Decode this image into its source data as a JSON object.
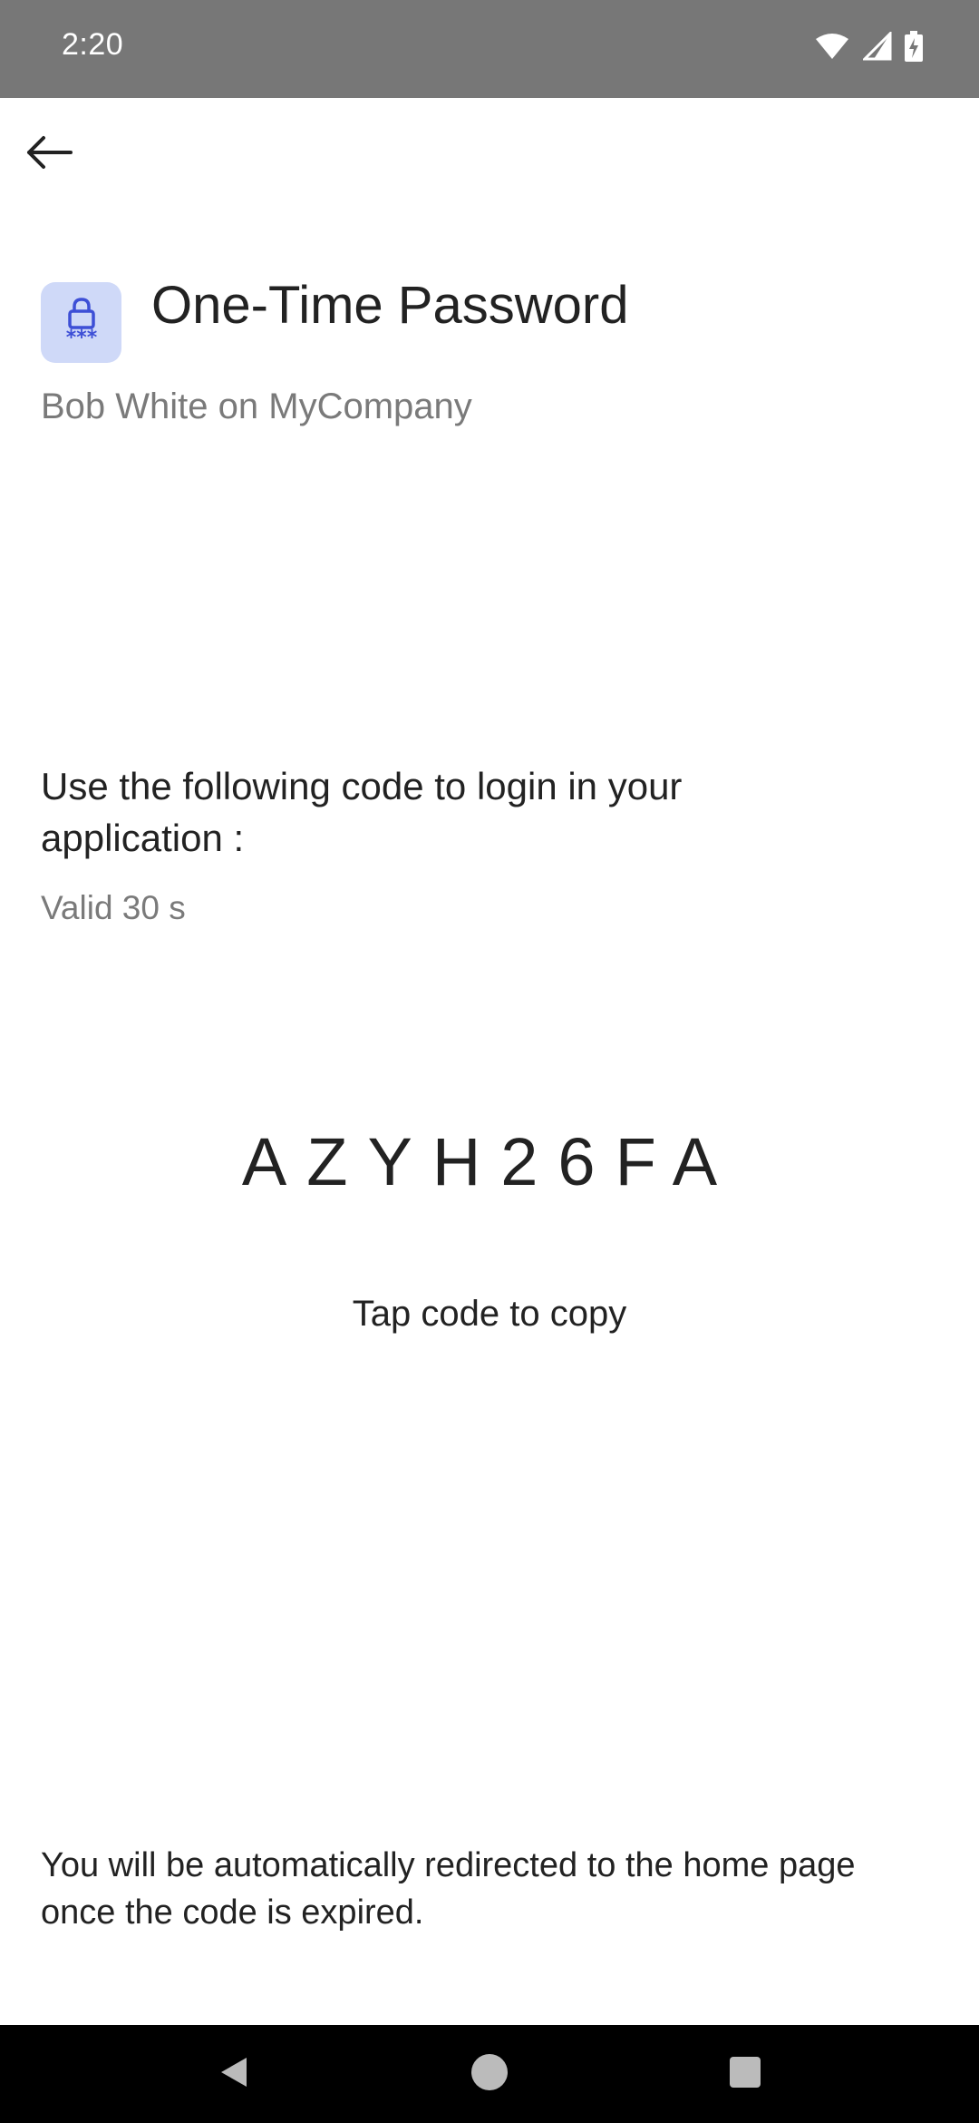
{
  "status_bar": {
    "time": "2:20"
  },
  "header": {
    "title": "One-Time Password",
    "subtitle": "Bob White on MyCompany"
  },
  "otp": {
    "instruction": "Use the following code to login in your application :",
    "validity": "Valid 30 s",
    "code": "AZYH26FA",
    "copy_hint": "Tap code to copy"
  },
  "footer": {
    "message": "You will be automatically redirected to the home page once the code is expired."
  },
  "icons": {
    "back": "arrow-back-icon",
    "app": "lock-password-icon",
    "wifi": "wifi-icon",
    "signal": "signal-icon",
    "battery": "battery-charging-icon"
  },
  "colors": {
    "status_bar": "#777777",
    "icon_bg": "#cfd9f8",
    "icon_accent": "#3d4fd6",
    "nav_bar": "#000000"
  }
}
